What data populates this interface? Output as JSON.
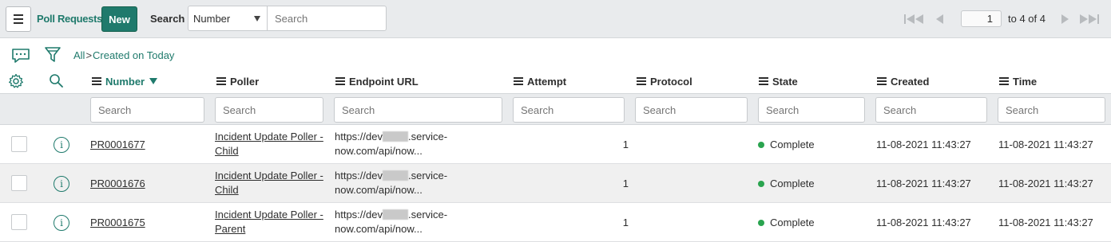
{
  "header": {
    "list_title": "Poll Requests",
    "new_label": "New",
    "search_label": "Search",
    "search_field": "Number",
    "search_placeholder": "Search",
    "page_current": "1",
    "page_summary": "to 4 of 4"
  },
  "breadcrumb": {
    "all": "All",
    "separator": ">",
    "condition": "Created on Today"
  },
  "columns": [
    {
      "label": "Number",
      "sorted": true
    },
    {
      "label": "Poller"
    },
    {
      "label": "Endpoint URL"
    },
    {
      "label": "Attempt"
    },
    {
      "label": "Protocol"
    },
    {
      "label": "State"
    },
    {
      "label": "Created"
    },
    {
      "label": "Time"
    }
  ],
  "column_search_placeholder": "Search",
  "rows": [
    {
      "number": "PR0001677",
      "poller_line1": "Incident Update Poller -",
      "poller_line2": "Child",
      "url_prefix": "https://dev",
      "url_suffix": ".service-",
      "url_line2": "now.com/api/now...",
      "attempt": "1",
      "protocol": "",
      "state": "Complete",
      "created": "11-08-2021 11:43:27",
      "time": "11-08-2021 11:43:27"
    },
    {
      "number": "PR0001676",
      "poller_line1": "Incident Update Poller -",
      "poller_line2": "Child",
      "url_prefix": "https://dev",
      "url_suffix": ".service-",
      "url_line2": "now.com/api/now...",
      "attempt": "1",
      "protocol": "",
      "state": "Complete",
      "created": "11-08-2021 11:43:27",
      "time": "11-08-2021 11:43:27"
    },
    {
      "number": "PR0001675",
      "poller_line1": "Incident Update Poller -",
      "poller_line2": "Parent",
      "url_prefix": "https://dev",
      "url_suffix": ".service-",
      "url_line2": "now.com/api/now...",
      "attempt": "1",
      "protocol": "",
      "state": "Complete",
      "created": "11-08-2021 11:43:27",
      "time": "11-08-2021 11:43:27"
    }
  ],
  "colors": {
    "accent": "#1f7a6c",
    "state_complete": "#2aa44f"
  },
  "icons": {
    "menu": "hamburger-menu-icon",
    "activity": "speech-bubble-icon",
    "filter": "funnel-filter-icon",
    "settings": "gear-icon",
    "search": "magnifier-icon",
    "info": "info-circle-icon",
    "first": "double-left-arrow-icon",
    "prev": "left-arrow-icon",
    "next": "right-arrow-icon",
    "last": "double-right-arrow-icon"
  }
}
